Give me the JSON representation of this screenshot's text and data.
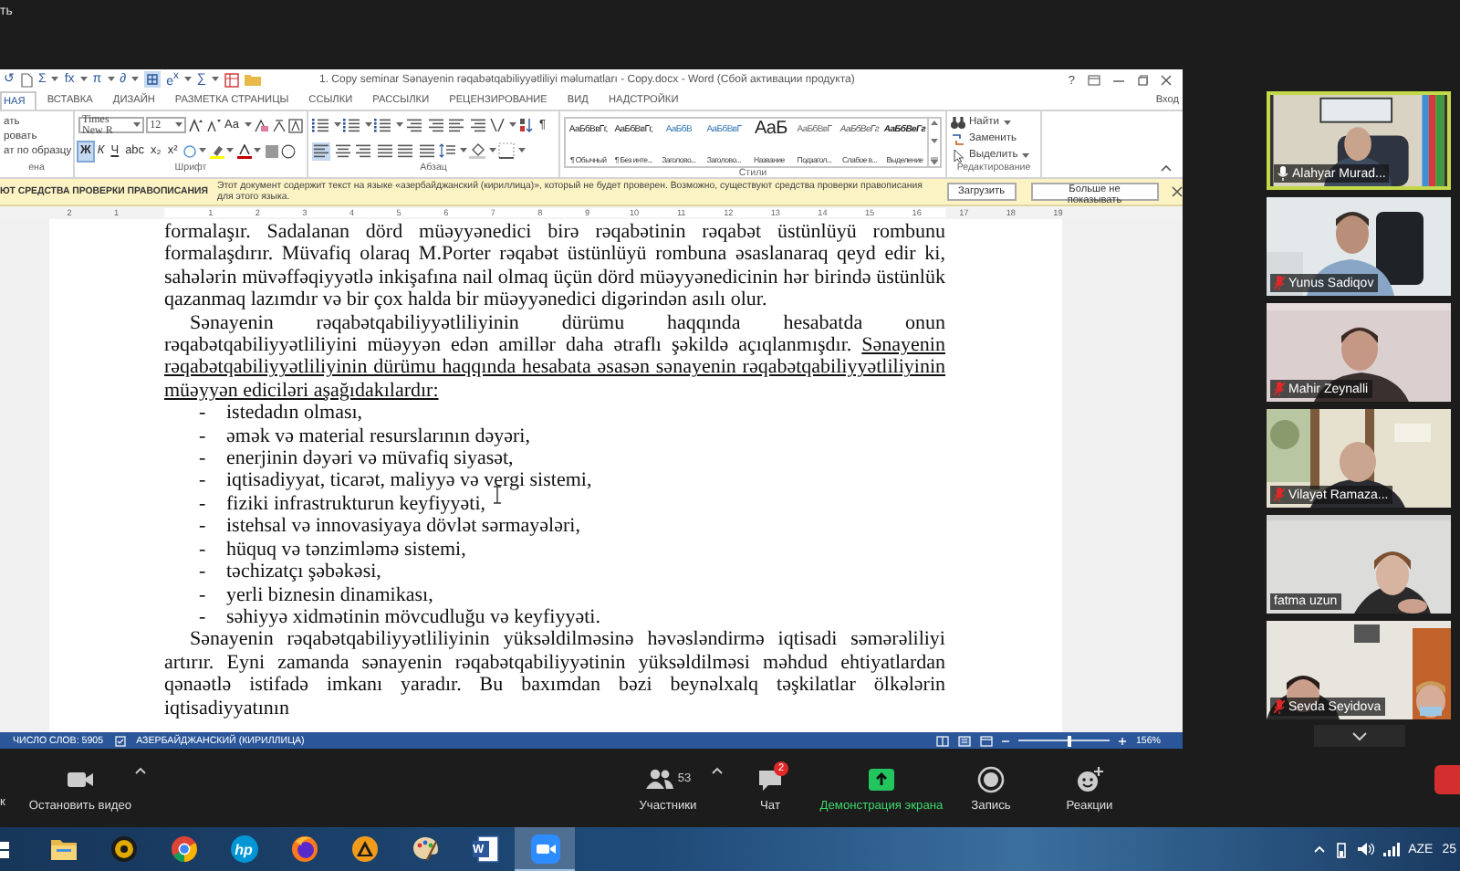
{
  "top_label": "ть",
  "word": {
    "quick_access": [
      "↺",
      "Σ",
      "fx",
      "π",
      "∂",
      "e$^{x}$",
      "∑"
    ],
    "title": "1. Copy seminar Sənayenin rəqabətqabiliyyətliliyi məlumatları - Copy.docx - Word (Сбой активации продукта)",
    "help": "?",
    "sign_in": "Вход",
    "tabs": [
      {
        "label": "НАЯ",
        "selected": true
      },
      {
        "label": "ВСТАВКА",
        "selected": false
      },
      {
        "label": "ДИЗАЙН",
        "selected": false
      },
      {
        "label": "РАЗМЕТКА СТРАНИЦЫ",
        "selected": false
      },
      {
        "label": "ССЫЛКИ",
        "selected": false
      },
      {
        "label": "РАССЫЛКИ",
        "selected": false
      },
      {
        "label": "РЕЦЕНЗИРОВАНИЕ",
        "selected": false
      },
      {
        "label": "ВИД",
        "selected": false
      },
      {
        "label": "НАДСТРОЙКИ",
        "selected": false
      }
    ],
    "clipboard": {
      "items": [
        "ать",
        "ровать",
        "ат по образцу"
      ],
      "label": "ена"
    },
    "font": {
      "name": "Times New R",
      "size": "12",
      "case_button": "Aa",
      "format_buttons": [
        {
          "label": "Ж",
          "selected": true
        },
        {
          "label": "К",
          "selected": false
        },
        {
          "label": "Ч",
          "selected": false
        },
        {
          "label": "abc",
          "selected": false
        },
        {
          "label": "x₂",
          "selected": false
        },
        {
          "label": "x²",
          "selected": false
        }
      ],
      "label": "Шрифт"
    },
    "paragraph": {
      "marks_button": "¶",
      "alignments": [
        {
          "selected": true
        },
        {
          "selected": false
        },
        {
          "selected": false
        },
        {
          "selected": false
        }
      ],
      "label": "Абзац"
    },
    "styles": {
      "items": [
        {
          "sample": "АаБбВвГг,",
          "name": "¶ Обычный",
          "kind": "normal"
        },
        {
          "sample": "АаБбВвГг,",
          "name": "¶ Без инте...",
          "kind": "normal"
        },
        {
          "sample": "АаБбВ",
          "name": "Заголово...",
          "kind": "heading"
        },
        {
          "sample": "АаБбВвГ",
          "name": "Заголово...",
          "kind": "heading2"
        },
        {
          "sample": "АаБ",
          "name": "Название",
          "kind": "title"
        },
        {
          "sample": "АаБбВвГ",
          "name": "Подзагол...",
          "kind": "subtitle"
        },
        {
          "sample": "АаБбВеГг",
          "name": "Слабое в...",
          "kind": "emphasis"
        },
        {
          "sample": "АаБбВеГг",
          "name": "Выделение",
          "kind": "strong"
        }
      ],
      "label": "Стили"
    },
    "editing": {
      "items": [
        "Найти",
        "Заменить",
        "Выделить"
      ],
      "label": "Редактирование"
    },
    "message_bar": {
      "title": "ЮТ СРЕДСТВА ПРОВЕРКИ ПРАВОПИСАНИЯ",
      "text": "Этот документ содержит текст на языке «азербайджанский (кириллица)», который не будет проверен. Возможно, существуют средства проверки правописания для этого языка.",
      "buttons": [
        "Загрузить",
        "Больше не показывать"
      ]
    },
    "ruler": {
      "left_numbers": [
        "2",
        "1"
      ],
      "numbers": [
        "1",
        "2",
        "3",
        "4",
        "5",
        "6",
        "7",
        "8",
        "9",
        "10",
        "11",
        "12",
        "13",
        "14",
        "15",
        "16",
        "17",
        "18",
        "19"
      ]
    },
    "document": {
      "blocks": [
        {
          "kind": "paragraph",
          "indent": false,
          "text": "formalaşır. Sadalanan dörd müəyyənedici birə rəqabətinin rəqabət üstünlüyü rombunu formalaşdırır. Müvafiq olaraq M.Porter rəqabət üstünlüyü rombuna əsaslanaraq qeyd edir ki, sahələrin müvəffəqiyyətlə inkişafına nail olmaq üçün dörd müəyyənedicinin hər birində üstünlük qazanmaq lazımdır və bir çox halda bir müəyyənedici digərindən asılı olur."
        },
        {
          "kind": "paragraph",
          "indent": true,
          "text": "Sənayenin rəqabətqabiliyyətliliyinin dürümu haqqında hesabatda onun rəqabətqabiliyyətliliyini müəyyən edən amillər daha ətraflı şəkildə açıqlanmışdır.",
          "underlined_text": "Sənayenin rəqabətqabiliyyətliliyinin dürümu haqqında hesabata əsasən sənayenin rəqabətqabiliyyətliliyinin müəyyən ediciləri aşağıdakılardır:"
        },
        {
          "kind": "list",
          "marker": "-",
          "items": [
            "istedadın olması,",
            "əmək və material resurslarının dəyəri,",
            "enerjinin dəyəri və müvafiq siyasət,",
            "iqtisadiyyat, ticarət, maliyyə və vergi sistemi,",
            "fiziki infrastrukturun keyfiyyəti,",
            "istehsal və innovasiyaya dövlət sərmayələri,",
            "hüquq və tənzimləmə sistemi,",
            "təchizatçı şəbəkəsi,",
            "yerli biznesin dinamikası,",
            "səhiyyə xidmətinin mövcudluğu və keyfiyyəti."
          ]
        },
        {
          "kind": "paragraph",
          "indent": true,
          "text": "Sənayenin rəqabətqabiliyyətliliyinin yüksəldilməsinə həvəsləndirmə iqtisadi səmərəliliyi artırır. Eyni zamanda sənayenin rəqabətqabiliyyətinin yüksəldilməsi məhdud ehtiyatlardan qənaətlə istifadə imkanı yaradır. Bu baxımdan bəzi beynəlxalq təşkilatlar ölkələrin iqtisadiyyatının"
        }
      ]
    },
    "status_bar": {
      "word_count": "ЧИСЛО СЛОВ: 5905",
      "language": "АЗЕРБАЙДЖАНСКИЙ (КИРИЛЛИЦА)",
      "zoom": "156%",
      "level": 0.55
    }
  },
  "participants": [
    {
      "name": "Alahyar Murad...",
      "kind": "mic",
      "active_speaker": true
    },
    {
      "name": "Yunus Sadiqov",
      "kind": "muted",
      "active_speaker": false
    },
    {
      "name": "Mahir Zeynalli",
      "kind": "muted",
      "active_speaker": false
    },
    {
      "name": "Vilayət Ramaza...",
      "kind": "muted",
      "active_speaker": false
    },
    {
      "name": "fatma uzun",
      "kind": "no-audio",
      "active_speaker": false
    },
    {
      "name": "Sevda Seyidova",
      "kind": "muted",
      "active_speaker": false
    }
  ],
  "toolbar": {
    "left_cut": "к",
    "items": [
      {
        "kind": "video",
        "label": "Остановить видео",
        "has_menu": true
      },
      {
        "kind": "participants",
        "label": "Участники",
        "count": "53",
        "has_menu": true
      },
      {
        "kind": "chat",
        "label": "Чат",
        "badge": "2",
        "has_menu": false
      },
      {
        "kind": "share",
        "label": "Демонстрация экрана",
        "has_menu": false
      },
      {
        "kind": "record",
        "label": "Запись",
        "has_menu": false
      },
      {
        "kind": "reactions",
        "label": "Реакции",
        "has_menu": false
      }
    ]
  },
  "taskbar": {
    "apps": [
      {
        "kind": "folder",
        "selected": false
      },
      {
        "kind": "media",
        "selected": false
      },
      {
        "kind": "chrome",
        "selected": false
      },
      {
        "kind": "hp",
        "label": "hp",
        "selected": false
      },
      {
        "kind": "firefox",
        "selected": false
      },
      {
        "kind": "aimp",
        "selected": false
      },
      {
        "kind": "paint",
        "selected": false
      },
      {
        "kind": "word",
        "label": "W",
        "selected": false
      },
      {
        "kind": "zoom",
        "selected": true
      }
    ],
    "language": "AZE",
    "clock": "25"
  }
}
